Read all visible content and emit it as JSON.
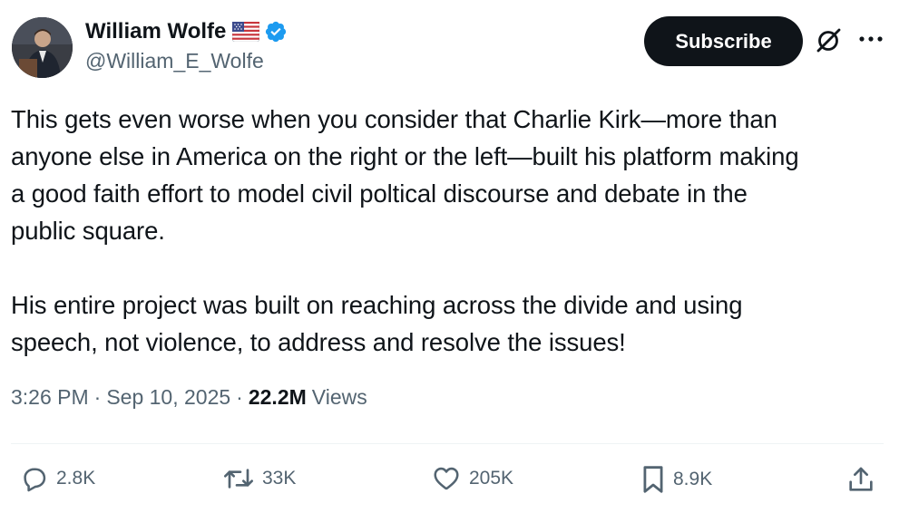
{
  "author": {
    "name": "William Wolfe",
    "handle": "@William_E_Wolfe",
    "flag": "us-flag-icon",
    "verified": true
  },
  "header": {
    "subscribe_label": "Subscribe",
    "grok_icon": "grok-icon",
    "more_icon": "more-icon"
  },
  "post": {
    "paragraphs": [
      "This gets even worse when you consider that Charlie Kirk—more than\nanyone else in America on the right or the left—built his platform making\na good faith effort to model civil poltical discourse and debate in the\npublic square.",
      "His entire project was built on reaching across the divide and using\nspeech, not violence, to address and resolve the issues!"
    ],
    "time": "3:26 PM",
    "separator": "·",
    "date": "Sep 10, 2025",
    "views_count": "22.2M",
    "views_label": "Views"
  },
  "actions": {
    "replies": "2.8K",
    "reposts": "33K",
    "likes": "205K",
    "bookmarks": "8.9K"
  },
  "colors": {
    "text": "#0f1419",
    "secondary": "#536471",
    "verified": "#1d9bf0",
    "divider": "#eff3f4"
  }
}
